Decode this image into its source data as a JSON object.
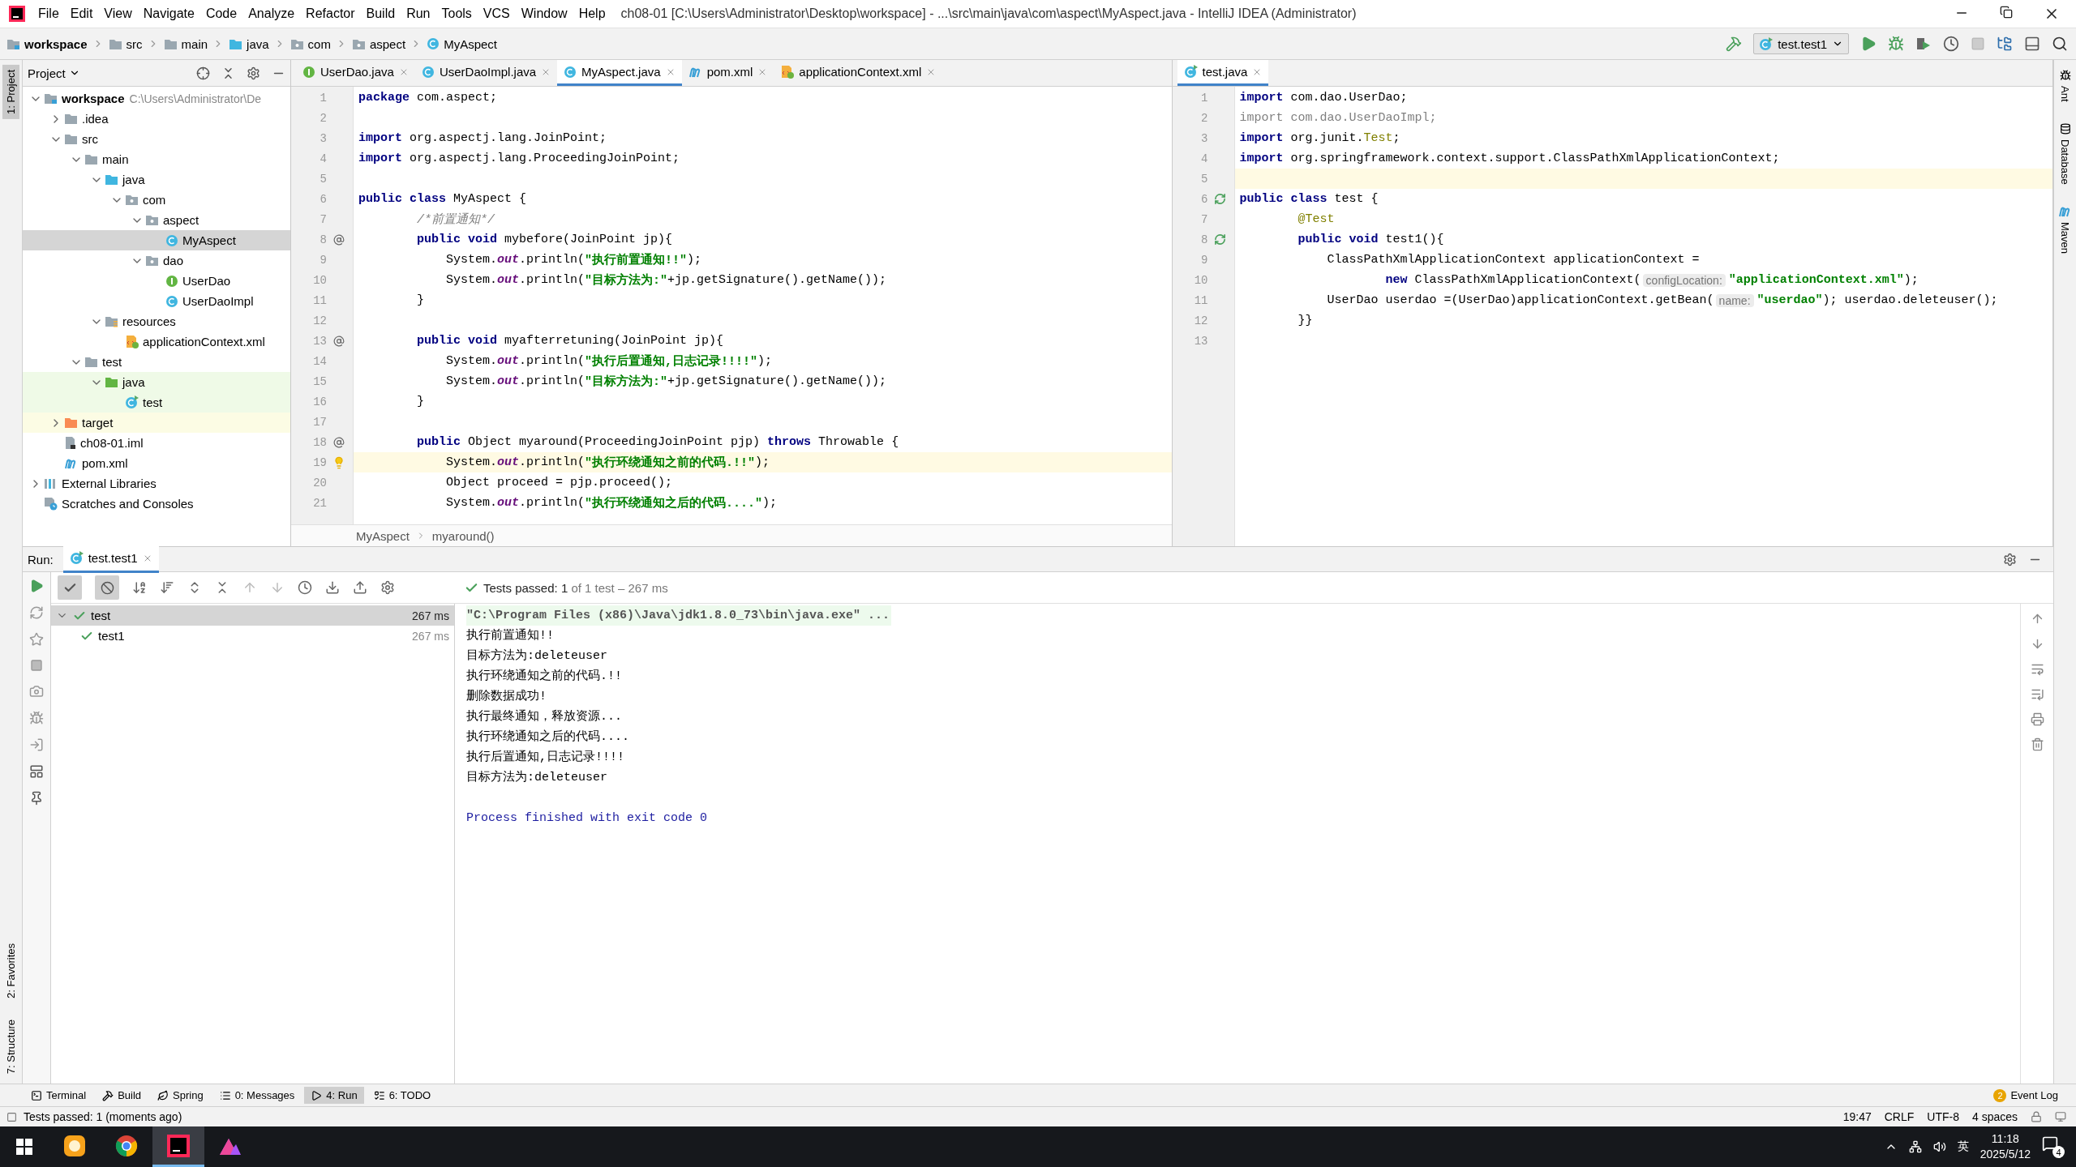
{
  "menu": [
    "File",
    "Edit",
    "View",
    "Navigate",
    "Code",
    "Analyze",
    "Refactor",
    "Build",
    "Run",
    "Tools",
    "VCS",
    "Window",
    "Help"
  ],
  "window_title": "ch08-01 [C:\\Users\\Administrator\\Desktop\\workspace] - ...\\src\\main\\java\\com\\aspect\\MyAspect.java - IntelliJ IDEA (Administrator)",
  "breadcrumbs": [
    {
      "label": "workspace",
      "kind": "module"
    },
    {
      "label": "src",
      "kind": "folder"
    },
    {
      "label": "main",
      "kind": "folder"
    },
    {
      "label": "java",
      "kind": "source-folder"
    },
    {
      "label": "com",
      "kind": "package"
    },
    {
      "label": "aspect",
      "kind": "package"
    },
    {
      "label": "MyAspect",
      "kind": "class"
    }
  ],
  "run_config": "test.test1",
  "tool_strips": {
    "left_top": [
      {
        "label": "1: Project",
        "selected": true
      }
    ],
    "left_bottom": [
      {
        "label": "2: Favorites",
        "selected": false
      },
      {
        "label": "7: Structure",
        "selected": false
      }
    ],
    "right": [
      "Ant",
      "Database",
      "Maven"
    ]
  },
  "project_panel": {
    "title": "Project",
    "tree": [
      {
        "label": "workspace",
        "path": "C:\\Users\\Administrator\\De",
        "kind": "module",
        "expanded": true,
        "selected": false,
        "children": [
          {
            "label": ".idea",
            "kind": "folder",
            "expanded": false,
            "selected": false
          },
          {
            "label": "src",
            "kind": "folder",
            "expanded": true,
            "selected": false,
            "children": [
              {
                "label": "main",
                "kind": "folder",
                "expanded": true,
                "selected": false,
                "children": [
                  {
                    "label": "java",
                    "kind": "source-folder",
                    "expanded": true,
                    "selected": false,
                    "children": [
                      {
                        "label": "com",
                        "kind": "package",
                        "expanded": true,
                        "selected": false,
                        "children": [
                          {
                            "label": "aspect",
                            "kind": "package",
                            "expanded": true,
                            "selected": false,
                            "children": [
                              {
                                "label": "MyAspect",
                                "kind": "class",
                                "selected": true
                              }
                            ]
                          },
                          {
                            "label": "dao",
                            "kind": "package",
                            "expanded": true,
                            "selected": false,
                            "children": [
                              {
                                "label": "UserDao",
                                "kind": "interface",
                                "selected": false
                              },
                              {
                                "label": "UserDaoImpl",
                                "kind": "class",
                                "selected": false
                              }
                            ]
                          }
                        ]
                      }
                    ]
                  },
                  {
                    "label": "resources",
                    "kind": "resources-folder",
                    "expanded": true,
                    "selected": false,
                    "children": [
                      {
                        "label": "applicationContext.xml",
                        "kind": "spring-xml",
                        "selected": false
                      }
                    ]
                  }
                ]
              },
              {
                "label": "test",
                "kind": "folder",
                "expanded": true,
                "selected": false,
                "children": [
                  {
                    "label": "java",
                    "kind": "test-folder",
                    "expanded": true,
                    "selected": false,
                    "children": [
                      {
                        "label": "test",
                        "kind": "test-class",
                        "selected": false
                      }
                    ]
                  }
                ]
              }
            ]
          },
          {
            "label": "target",
            "kind": "excluded-folder",
            "expanded": false,
            "selected": false
          },
          {
            "label": "ch08-01.iml",
            "kind": "iml",
            "selected": false
          },
          {
            "label": "pom.xml",
            "kind": "maven",
            "selected": false
          }
        ]
      },
      {
        "label": "External Libraries",
        "kind": "libraries",
        "expanded": false,
        "selected": false
      },
      {
        "label": "Scratches and Consoles",
        "kind": "scratches",
        "selected": false
      }
    ]
  },
  "editor_left": {
    "tabs": [
      {
        "label": "UserDao.java",
        "kind": "interface",
        "selected": false
      },
      {
        "label": "UserDaoImpl.java",
        "kind": "class",
        "selected": false
      },
      {
        "label": "MyAspect.java",
        "kind": "class",
        "selected": true
      },
      {
        "label": "pom.xml",
        "kind": "maven",
        "selected": false
      },
      {
        "label": "applicationContext.xml",
        "kind": "spring-xml",
        "selected": false
      }
    ],
    "lines": [
      {
        "n": "1",
        "current": false,
        "segments": [
          {
            "kind": "keyword",
            "t": "package"
          },
          {
            "kind": "plain",
            "t": " com.aspect;"
          }
        ]
      },
      {
        "n": "2",
        "current": false
      },
      {
        "n": "3",
        "current": false,
        "segments": [
          {
            "kind": "keyword",
            "t": "import"
          },
          {
            "kind": "plain",
            "t": " org.aspectj.lang.JoinPoint;"
          }
        ]
      },
      {
        "n": "4",
        "current": false,
        "segments": [
          {
            "kind": "keyword",
            "t": "import"
          },
          {
            "kind": "plain",
            "t": " org.aspectj.lang.ProceedingJoinPoint;"
          }
        ]
      },
      {
        "n": "5",
        "current": false
      },
      {
        "n": "6",
        "current": false,
        "segments": [
          {
            "kind": "keyword",
            "t": "public class"
          },
          {
            "kind": "plain",
            "t": " MyAspect {"
          }
        ]
      },
      {
        "n": "7",
        "current": false,
        "segments": [
          {
            "kind": "comment",
            "t": "        /*前置通知*/"
          }
        ]
      },
      {
        "n": "8",
        "current": false,
        "gutter": {
          "kind": "override"
        },
        "segments": [
          {
            "kind": "keyword",
            "t": "        public void"
          },
          {
            "kind": "plain",
            "t": " mybefore(JoinPoint jp){"
          }
        ]
      },
      {
        "n": "9",
        "current": false,
        "segments": [
          {
            "kind": "plain",
            "t": "            System."
          },
          {
            "kind": "field",
            "t": "out"
          },
          {
            "kind": "plain",
            "t": ".println("
          },
          {
            "kind": "string",
            "t": "\"执行前置通知!!\""
          },
          {
            "kind": "plain",
            "t": ");"
          }
        ]
      },
      {
        "n": "10",
        "current": false,
        "segments": [
          {
            "kind": "plain",
            "t": "            System."
          },
          {
            "kind": "field",
            "t": "out"
          },
          {
            "kind": "plain",
            "t": ".println("
          },
          {
            "kind": "string",
            "t": "\"目标方法为:\""
          },
          {
            "kind": "plain",
            "t": "+jp.getSignature().getName());"
          }
        ]
      },
      {
        "n": "11",
        "current": false,
        "segments": [
          {
            "kind": "plain",
            "t": "        }"
          }
        ]
      },
      {
        "n": "12",
        "current": false
      },
      {
        "n": "13",
        "current": false,
        "gutter": {
          "kind": "override"
        },
        "segments": [
          {
            "kind": "keyword",
            "t": "        public void"
          },
          {
            "kind": "plain",
            "t": " myafterretuning(JoinPoint jp){"
          }
        ]
      },
      {
        "n": "14",
        "current": false,
        "segments": [
          {
            "kind": "plain",
            "t": "            System."
          },
          {
            "kind": "field",
            "t": "out"
          },
          {
            "kind": "plain",
            "t": ".println("
          },
          {
            "kind": "string",
            "t": "\"执行后置通知,日志记录!!!!\""
          },
          {
            "kind": "plain",
            "t": ");"
          }
        ]
      },
      {
        "n": "15",
        "current": false,
        "segments": [
          {
            "kind": "plain",
            "t": "            System."
          },
          {
            "kind": "field",
            "t": "out"
          },
          {
            "kind": "plain",
            "t": ".println("
          },
          {
            "kind": "string",
            "t": "\"目标方法为:\""
          },
          {
            "kind": "plain",
            "t": "+jp.getSignature().getName());"
          }
        ]
      },
      {
        "n": "16",
        "current": false,
        "segments": [
          {
            "kind": "plain",
            "t": "        }"
          }
        ]
      },
      {
        "n": "17",
        "current": false
      },
      {
        "n": "18",
        "current": false,
        "gutter": {
          "kind": "override"
        },
        "segments": [
          {
            "kind": "keyword",
            "t": "        public"
          },
          {
            "kind": "plain",
            "t": " Object myaround(ProceedingJoinPoint pjp) "
          },
          {
            "kind": "keyword",
            "t": "throws"
          },
          {
            "kind": "plain",
            "t": " Throwable {"
          }
        ]
      },
      {
        "n": "19",
        "current": true,
        "gutter": {
          "kind": "bulb"
        },
        "segments": [
          {
            "kind": "plain",
            "t": "            System."
          },
          {
            "kind": "field",
            "t": "out"
          },
          {
            "kind": "plain",
            "t": ".println("
          },
          {
            "kind": "string",
            "t": "\"执行环绕通知之前的代码.!!\""
          },
          {
            "kind": "plain",
            "t": ");"
          }
        ]
      },
      {
        "n": "20",
        "current": false,
        "segments": [
          {
            "kind": "plain",
            "t": "            Object proceed = pjp.proceed();"
          }
        ]
      },
      {
        "n": "21",
        "current": false,
        "segments": [
          {
            "kind": "plain",
            "t": "            System."
          },
          {
            "kind": "field",
            "t": "out"
          },
          {
            "kind": "plain",
            "t": ".println("
          },
          {
            "kind": "string",
            "t": "\"执行环绕通知之后的代码....\""
          },
          {
            "kind": "plain",
            "t": ");"
          }
        ]
      }
    ],
    "breadcrumbs": [
      "MyAspect",
      "myaround()"
    ]
  },
  "editor_right": {
    "tabs": [
      {
        "label": "test.java",
        "kind": "test-class",
        "selected": true
      }
    ],
    "lines": [
      {
        "n": "1",
        "current": false,
        "segments": [
          {
            "kind": "keyword",
            "t": "import"
          },
          {
            "kind": "plain",
            "t": " com.dao.UserDao;"
          }
        ]
      },
      {
        "n": "2",
        "current": false,
        "segments": [
          {
            "kind": "unused",
            "t": "import com.dao.UserDaoImpl;"
          }
        ]
      },
      {
        "n": "3",
        "current": false,
        "segments": [
          {
            "kind": "keyword",
            "t": "import"
          },
          {
            "kind": "plain",
            "t": " org.junit."
          },
          {
            "kind": "annotation",
            "t": "Test"
          },
          {
            "kind": "plain",
            "t": ";"
          }
        ]
      },
      {
        "n": "4",
        "current": false,
        "segments": [
          {
            "kind": "keyword",
            "t": "import"
          },
          {
            "kind": "plain",
            "t": " org.springframework.context.support.ClassPathXmlApplicationContext;"
          }
        ]
      },
      {
        "n": "5",
        "current": true
      },
      {
        "n": "6",
        "current": false,
        "gutter": {
          "kind": "run"
        },
        "segments": [
          {
            "kind": "keyword",
            "t": "public class"
          },
          {
            "kind": "plain",
            "t": " test {"
          }
        ]
      },
      {
        "n": "7",
        "current": false,
        "segments": [
          {
            "kind": "annotation",
            "t": "        @Test"
          }
        ]
      },
      {
        "n": "8",
        "current": false,
        "gutter": {
          "kind": "run"
        },
        "segments": [
          {
            "kind": "keyword",
            "t": "        public void"
          },
          {
            "kind": "plain",
            "t": " test1(){"
          }
        ]
      },
      {
        "n": "9",
        "current": false,
        "segments": [
          {
            "kind": "plain",
            "t": "            ClassPathXmlApplicationContext applicationContext ="
          }
        ]
      },
      {
        "n": "10",
        "current": false,
        "segments": [
          {
            "kind": "keyword",
            "t": "                    new"
          },
          {
            "kind": "plain",
            "t": " ClassPathXmlApplicationContext("
          },
          {
            "kind": "hint",
            "t": "configLocation:"
          },
          {
            "kind": "string",
            "t": "\"applicationContext.xml\""
          },
          {
            "kind": "plain",
            "t": ");"
          }
        ]
      },
      {
        "n": "11",
        "current": false,
        "segments": [
          {
            "kind": "plain",
            "t": "            UserDao userdao =(UserDao)applicationContext.getBean("
          },
          {
            "kind": "hint",
            "t": "name:"
          },
          {
            "kind": "string",
            "t": "\"userdao\""
          },
          {
            "kind": "plain",
            "t": "); userdao.deleteuser();"
          }
        ]
      },
      {
        "n": "12",
        "current": false,
        "segments": [
          {
            "kind": "plain",
            "t": "        }}"
          }
        ]
      },
      {
        "n": "13",
        "current": false
      }
    ]
  },
  "run_panel": {
    "label": "Run:",
    "tab": "test.test1",
    "show_passed": true,
    "show_ignored": true,
    "summary": "**Tests passed: 1** of 1 test – 267 ms",
    "tests": [
      {
        "name": "test",
        "time": "267 ms",
        "expanded": true,
        "selected": true,
        "children": [
          {
            "name": "test1",
            "time": "267 ms",
            "selected": false
          }
        ]
      }
    ],
    "console": [
      {
        "kind": "command",
        "text": "\"C:\\Program Files (x86)\\Java\\jdk1.8.0_73\\bin\\java.exe\" ..."
      },
      {
        "kind": "output",
        "text": "执行前置通知!!"
      },
      {
        "kind": "output",
        "text": "目标方法为:deleteuser"
      },
      {
        "kind": "output",
        "text": "执行环绕通知之前的代码.!!"
      },
      {
        "kind": "output",
        "text": "删除数据成功!"
      },
      {
        "kind": "output",
        "text": "执行最终通知，释放资源..."
      },
      {
        "kind": "output",
        "text": "执行环绕通知之后的代码...."
      },
      {
        "kind": "output",
        "text": "执行后置通知,日志记录!!!!"
      },
      {
        "kind": "output",
        "text": "目标方法为:deleteuser"
      },
      {
        "kind": "exit",
        "text": "Process finished with exit code 0"
      }
    ]
  },
  "tool_buttons": [
    {
      "label": "Terminal",
      "kind": "terminal",
      "selected": false
    },
    {
      "label": "Build",
      "kind": "hammer",
      "selected": false
    },
    {
      "label": "Spring",
      "kind": "leaf",
      "selected": false
    },
    {
      "label": "0: Messages",
      "kind": "list",
      "selected": false
    },
    {
      "label": "4: Run",
      "kind": "play",
      "selected": true
    },
    {
      "label": "6: TODO",
      "kind": "todo",
      "selected": false
    }
  ],
  "event_log": {
    "label": "Event Log",
    "count": "2"
  },
  "status_bar": {
    "message": "Tests passed: 1 (moments ago)",
    "items": [
      "19:47",
      "CRLF",
      "UTF-8",
      "4 spaces"
    ]
  },
  "taskbar": {
    "apps": [
      {
        "kind": "fox",
        "selected": false
      },
      {
        "kind": "globe",
        "selected": false
      },
      {
        "kind": "ide",
        "selected": true
      },
      {
        "kind": "mountain",
        "selected": false
      }
    ],
    "ime": "英",
    "time": "11:18",
    "date": "2025/5/12",
    "notifications": "4"
  }
}
